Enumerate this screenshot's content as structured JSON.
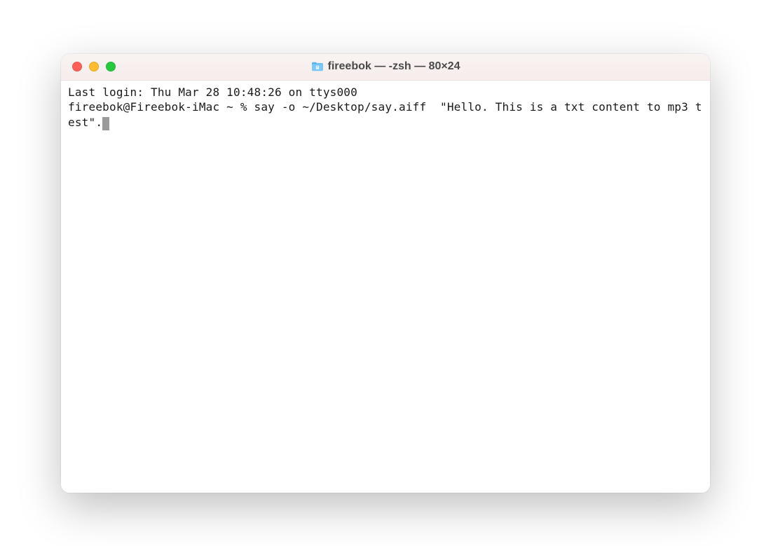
{
  "window": {
    "title": "fireebok — -zsh — 80×24"
  },
  "terminal": {
    "line1": "Last login: Thu Mar 28 10:48:26 on ttys000",
    "prompt": "fireebok@Fireebok-iMac ~ % ",
    "command": "say -o ~/Desktop/say.aiff  \"Hello. This is a txt content to mp3 test\"."
  }
}
